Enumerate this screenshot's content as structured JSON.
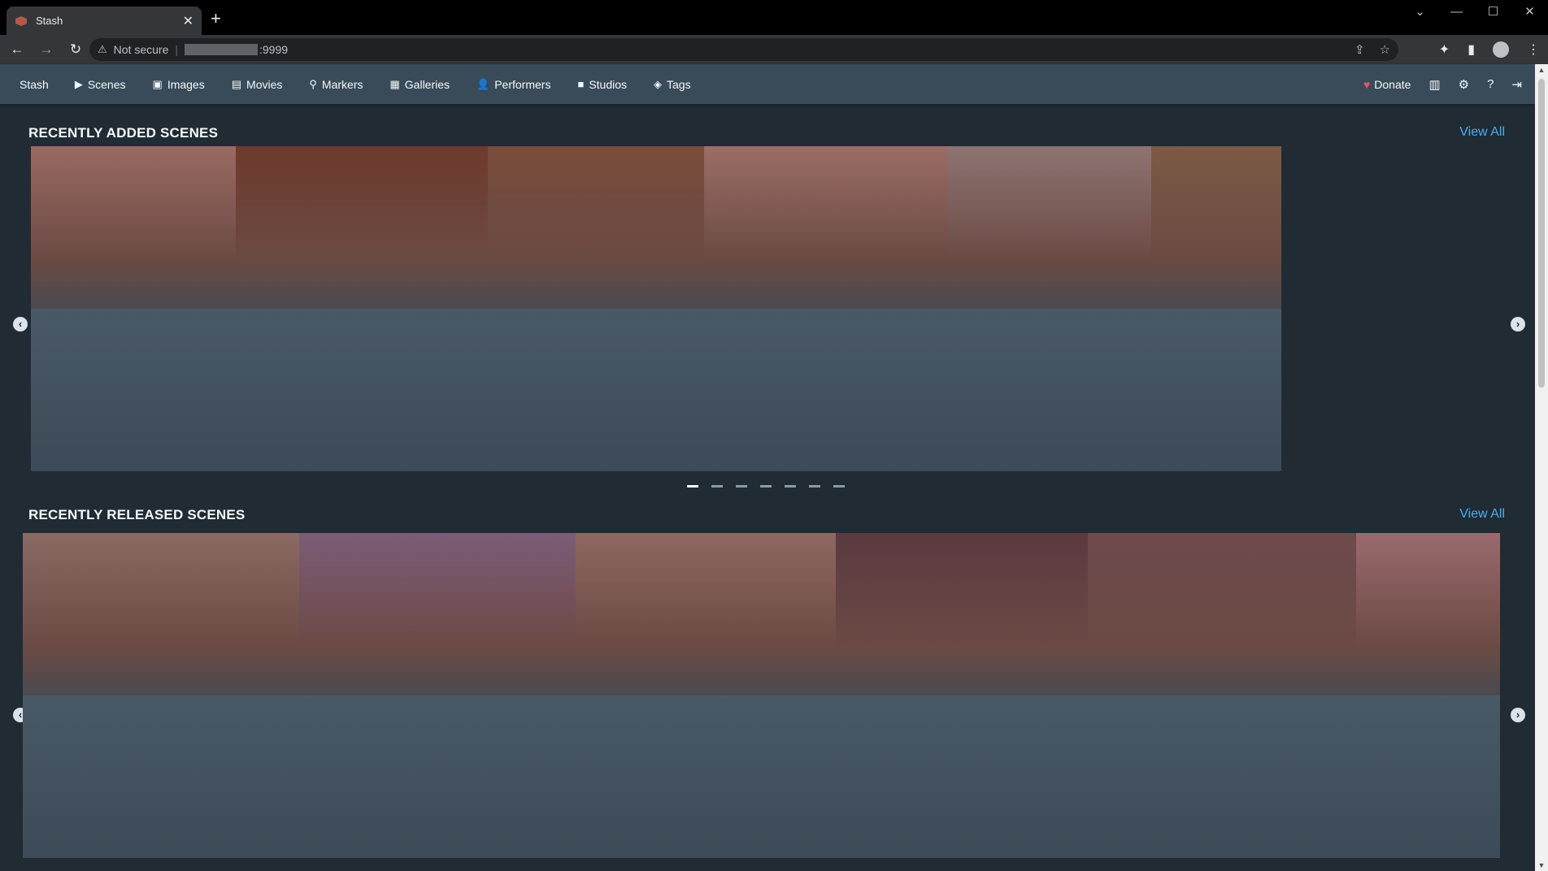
{
  "browser": {
    "tab_title": "Stash",
    "new_tab": "+",
    "not_secure": "Not secure",
    "url_suffix": ":9999",
    "window_controls": [
      "⌄",
      "—",
      "☐",
      "✕"
    ]
  },
  "navbar": {
    "brand": "Stash",
    "items": [
      {
        "label": "Scenes",
        "icon": "play-circle-icon",
        "glyph": "▶"
      },
      {
        "label": "Images",
        "icon": "image-icon",
        "glyph": "▣"
      },
      {
        "label": "Movies",
        "icon": "film-icon",
        "glyph": "▤"
      },
      {
        "label": "Markers",
        "icon": "map-marker-icon",
        "glyph": "⚲"
      },
      {
        "label": "Galleries",
        "icon": "images-icon",
        "glyph": "▦"
      },
      {
        "label": "Performers",
        "icon": "user-icon",
        "glyph": "👤"
      },
      {
        "label": "Studios",
        "icon": "video-icon",
        "glyph": "■"
      },
      {
        "label": "Tags",
        "icon": "tag-icon",
        "glyph": "◈"
      }
    ],
    "donate": "Donate",
    "right_icons": [
      "stats-icon",
      "settings-icon",
      "help-icon",
      "logout-icon"
    ]
  },
  "sections": [
    {
      "title": "RECENTLY ADDED SCENES",
      "view_all": "View All",
      "dot_count": 7,
      "active_dot": 0,
      "card_widths": [
        252,
        310,
        266,
        300,
        250,
        160
      ],
      "thumb_colors": [
        "#9a6a62",
        "#6e3a2c",
        "#7a4d3c",
        "#9b6e66",
        "#8e7472",
        "#7c5a44"
      ],
      "body_color": "#3c4b57"
    },
    {
      "title": "RECENTLY RELEASED SCENES",
      "view_all": "View All",
      "dot_count": 7,
      "active_dot": 0,
      "card_widths": [
        340,
        340,
        320,
        310,
        330,
        177
      ],
      "thumb_colors": [
        "#8a6a62",
        "#7c5c78",
        "#8e6860",
        "#5a3a40",
        "#6e4a4c",
        "#9a6a6e"
      ],
      "body_color": "#3c4b57"
    }
  ],
  "colors": {
    "background": "#202b33",
    "navbar": "#394b59",
    "link": "#48aff0",
    "heart": "#e9546b"
  }
}
